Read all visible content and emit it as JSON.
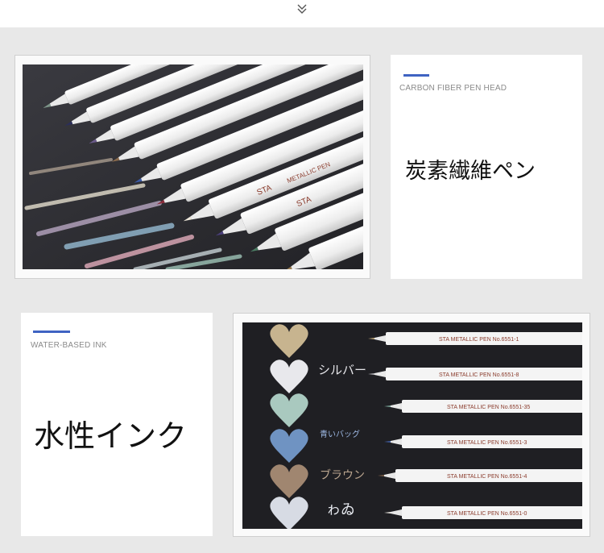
{
  "colors": {
    "accent": "#3f63c2",
    "page_bg": "#e8e8e8",
    "card_bg": "#ffffff",
    "board": "#2b2b30"
  },
  "header": {
    "chevron_icon": "chevron-double-down-icon"
  },
  "feature_carbon": {
    "label_en": "CARBON FIBER PEN HEAD",
    "title_jp": "炭素繊維ペン"
  },
  "feature_water": {
    "label_en": "WATER-BASED INK",
    "title_jp": "水性インク"
  },
  "pen_photo": {
    "brand": "STA",
    "pen_label": "METALLIC PEN"
  },
  "swatch_photo": {
    "rows": [
      {
        "word": "",
        "pen_text": "STA  METALLIC PEN  No.6551-1"
      },
      {
        "word": "シルバー",
        "pen_text": "STA  METALLIC PEN  No.6551-8"
      },
      {
        "word": "",
        "pen_text": "STA  METALLIC PEN  No.6551-35"
      },
      {
        "word": "青いバッグ",
        "pen_text": "STA  METALLIC PEN  No.6551-3"
      },
      {
        "word": "ブラウン",
        "pen_text": "STA  METALLIC PEN  No.6551-4"
      },
      {
        "word": "ゎゐ",
        "pen_text": "STA  METALLIC PEN  No.6551-0"
      }
    ]
  }
}
